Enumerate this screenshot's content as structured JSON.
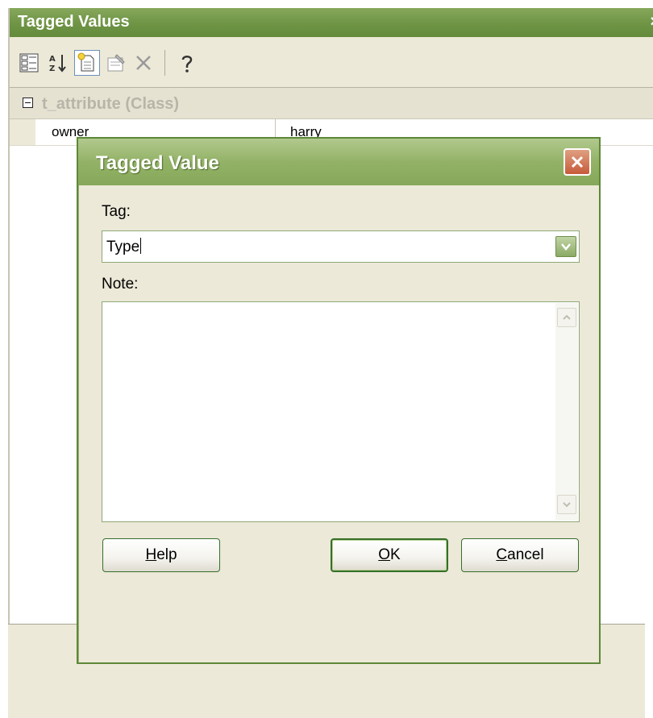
{
  "panel": {
    "title": "Tagged Values",
    "close_glyph": "×"
  },
  "toolbar": {
    "buttons": [
      {
        "icon": "categorized-view-icon"
      },
      {
        "icon": "sort-alphabetical-icon"
      },
      {
        "icon": "new-tag-icon",
        "pressed": true
      },
      {
        "icon": "properties-icon"
      },
      {
        "icon": "delete-icon"
      },
      {
        "icon": "help-icon"
      }
    ]
  },
  "grid": {
    "group_label": "t_attribute (Class)",
    "rows": [
      {
        "key": "owner",
        "value": "harry"
      }
    ]
  },
  "dialog": {
    "title": "Tagged Value",
    "tag_label": "Tag:",
    "tag_value": "Type",
    "note_label": "Note:",
    "note_value": "",
    "help_button": {
      "mnemonic": "H",
      "rest": "elp"
    },
    "ok_button": {
      "mnemonic": "O",
      "rest": "K"
    },
    "cancel_button": {
      "mnemonic": "C",
      "rest": "ancel"
    }
  },
  "colors": {
    "title_green": "#6e9444",
    "dialog_border": "#5d8838",
    "close_red": "#c65b3b",
    "chrome": "#ece9d8"
  }
}
